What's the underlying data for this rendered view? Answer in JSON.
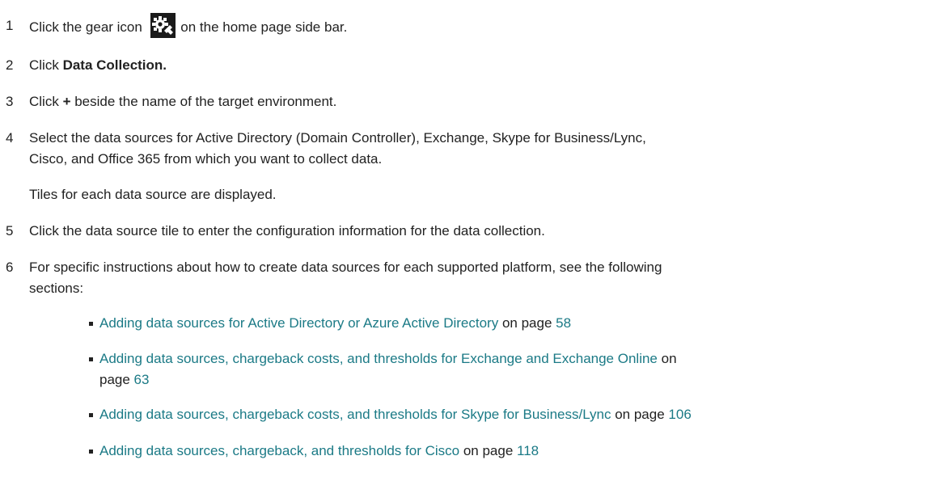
{
  "steps": [
    {
      "num": "1",
      "pre": "Click the gear icon",
      "post": "on the home page side bar.",
      "icon": "gear-icon"
    },
    {
      "num": "2",
      "pre": "Click ",
      "bold": "Data Collection."
    },
    {
      "num": "3",
      "pre": "Click ",
      "bold": "+",
      "post": " beside the name of the target environment."
    },
    {
      "num": "4",
      "line1": "Select the data sources for Active Directory (Domain Controller), Exchange, Skype for Business/Lync,",
      "line2": "Cisco, and Office 365 from which you want to collect data."
    },
    {
      "num": "5",
      "text": "Click the data source tile to enter the configuration information for the data collection."
    },
    {
      "num": "6",
      "line1": "For specific instructions about how to create data sources for each supported platform, see the following",
      "line2": "sections:"
    }
  ],
  "note": "Tiles for each data source are displayed.",
  "links": [
    {
      "title": "Adding data sources for Active Directory or Azure Active Directory",
      "on_page": " on page ",
      "page": "58"
    },
    {
      "title": "Adding data sources, chargeback costs, and thresholds for Exchange and Exchange Online",
      "on_page": " on",
      "on_page2": "page ",
      "page": "63"
    },
    {
      "title": "Adding data sources, chargeback costs, and thresholds for Skype for Business/Lync",
      "on_page": " on page ",
      "page": "106"
    },
    {
      "title": "Adding data sources, chargeback, and thresholds for Cisco",
      "on_page": " on page ",
      "page": "118"
    }
  ],
  "colors": {
    "link": "#1b7a86",
    "text": "#222222",
    "icon_bg": "#1a1a1a"
  }
}
